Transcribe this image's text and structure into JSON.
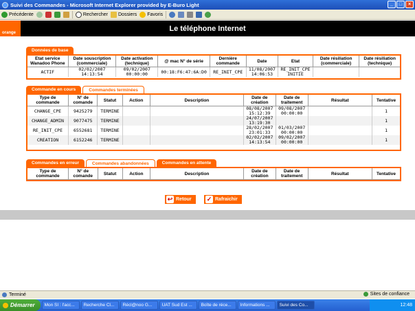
{
  "window": {
    "title": "Suivi des Commandes - Microsoft Internet Explorer provided by E-Buro Light"
  },
  "toolbar": {
    "back": "Précédente",
    "search": "Rechercher",
    "folders": "Dossiers",
    "favorites": "Favoris"
  },
  "header": {
    "logo": "orange",
    "title": "Le téléphone Internet"
  },
  "base": {
    "tab": "Données de base",
    "headers": [
      "Etat service Wanadoo Phone",
      "Date souscription (commerciale)",
      "Date activation (technique)",
      "@ mac N° de série",
      "Dernière commande",
      "Date",
      "Etat",
      "Date résiliation (commerciale)",
      "Date résiliation (technique)"
    ],
    "row": [
      "ACTIF",
      "02/02/2007 14:13:54",
      "09/02/2007 00:00:00",
      "00:18:F6:47:6A:D0",
      "RE_INIT_CPE",
      "11/08/2007 14:06:53",
      "RE_INIT_CPE INITIE",
      "",
      ""
    ]
  },
  "orders": {
    "tabs": [
      "Commande en cours",
      "Commandes terminées"
    ],
    "headers": [
      "Type de commande",
      "N° de comande",
      "Statut",
      "Action",
      "Description",
      "Date de création",
      "Date de traitement",
      "Résultat",
      "Tentative"
    ],
    "rows": [
      [
        "CHANGE_CPE",
        "9425279",
        "TERMINE",
        "",
        "",
        "08/08/2007 15:12:39",
        "09/08/2007 00:00:00",
        "",
        "1"
      ],
      [
        "CHANGE_ADMIN",
        "9077475",
        "TERMINE",
        "",
        "",
        "24/07/2007 13:19:30",
        "",
        "",
        "1"
      ],
      [
        "RE_INIT_CPE",
        "6552681",
        "TERMINE",
        "",
        "",
        "28/02/2007 23:01:33",
        "01/03/2007 00:00:00",
        "",
        "1"
      ],
      [
        "CREATION",
        "6152246",
        "TERMINE",
        "",
        "",
        "02/02/2007 14:13:54",
        "09/02/2007 00:00:00",
        "",
        "1"
      ]
    ]
  },
  "errors": {
    "tabs": [
      "Commandes en erreur",
      "Commandes abandonnées",
      "Commandes en attente"
    ],
    "headers": [
      "Type de commande",
      "N° de comande",
      "Statut",
      "Action",
      "Description",
      "Date de création",
      "Date de traitement",
      "Résultat",
      "Tentative"
    ]
  },
  "buttons": {
    "back": "Retour",
    "refresh": "Rafraichir"
  },
  "status": {
    "text": "Terminé",
    "zone": "Sites de confiance"
  },
  "taskbar": {
    "start": "Démarrer",
    "tasks": [
      "Mon SI : l'acc...",
      "Recherche Cl...",
      "Récl@noo G...",
      "UAT Sud Est ...",
      "Boîte de réce...",
      "Informations ...",
      "Suivi des Co..."
    ],
    "clock": "12:48"
  }
}
